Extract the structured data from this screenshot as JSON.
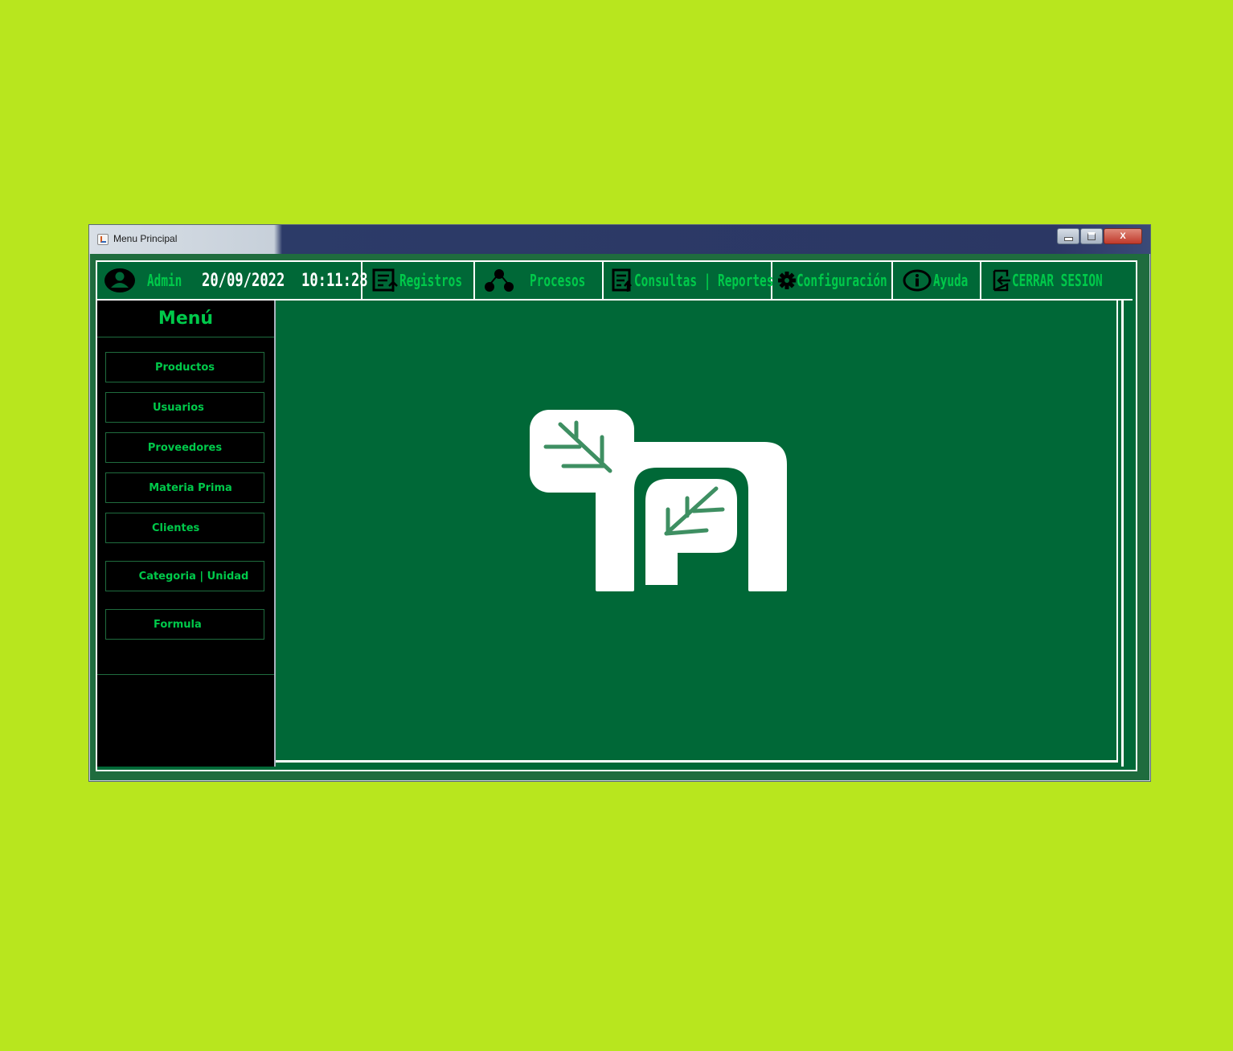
{
  "window": {
    "title": "Menu Principal",
    "close_label": "X"
  },
  "topbar": {
    "user_label": "Admin",
    "date": "20/09/2022",
    "time": "10:11:28",
    "items": [
      {
        "label": "Registros",
        "icon": "document-upload-icon"
      },
      {
        "label": "Procesos",
        "icon": "network-nodes-icon"
      },
      {
        "label": "Consultas | Reportes",
        "icon": "document-upload-icon"
      },
      {
        "label": "Configuración",
        "icon": "gear-icon"
      },
      {
        "label": "Ayuda",
        "icon": "info-icon"
      },
      {
        "label": "CERRAR SESION",
        "icon": "logout-icon"
      }
    ]
  },
  "sidebar": {
    "title": "Menú",
    "items": [
      {
        "label": "Productos"
      },
      {
        "label": "Usuarios"
      },
      {
        "label": "Proveedores"
      },
      {
        "label": "Materia Prima"
      },
      {
        "label": "Clientes"
      },
      {
        "label": "Categoria | Unidad"
      },
      {
        "label": "Formula"
      }
    ]
  },
  "colors": {
    "page_background": "#b8e61e",
    "panel_green": "#006837",
    "accent_green": "#00c94a",
    "sidebar_black": "#000000"
  }
}
